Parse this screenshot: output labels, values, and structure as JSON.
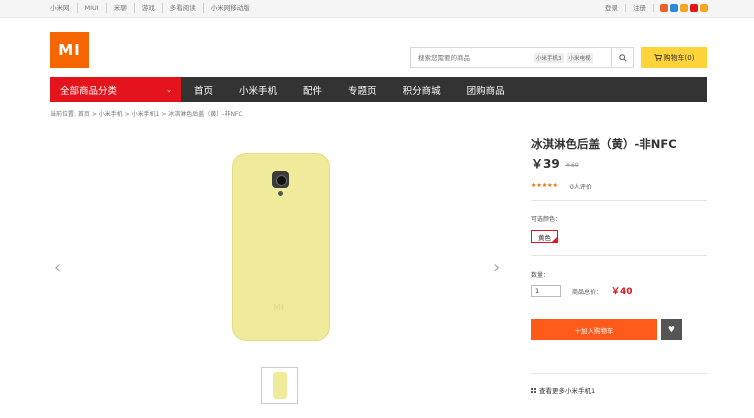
{
  "topbar": {
    "links": [
      "小米网",
      "MIUI",
      "米聊",
      "游戏",
      "多看阅读",
      "小米网移动版"
    ],
    "login": "登录",
    "register": "注册",
    "social_colors": [
      "#e8632c",
      "#2b8bd6",
      "#f5a623",
      "#e4141c",
      "#f5a623"
    ]
  },
  "header": {
    "logo_text": "MI",
    "logo_color": "#f56600",
    "search_placeholder": "搜索您需要的商品",
    "search_tags": [
      "小米手机3",
      "小米电视"
    ],
    "cart_label": "购物车(0)",
    "cart_color": "#ffd43b"
  },
  "nav": {
    "category_label": "全部商品分类",
    "category_color": "#e4141c",
    "items": [
      "首页",
      "小米手机",
      "配件",
      "专题页",
      "积分商城",
      "团购商品"
    ]
  },
  "breadcrumb": "当前位置: 首页 > 小米手机 > 小米手机1 > 冰淇淋色后盖（黄）-非NFC",
  "product": {
    "title": "冰淇淋色后盖（黄）-非NFC",
    "price": "￥39",
    "old_price": "￥69",
    "stars": "★★★★★",
    "rating_value": 5,
    "reviews": "0人评价",
    "color_label": "可选颜色：",
    "color_option": "黄色",
    "qty_label": "数量：",
    "qty_value": "1",
    "total_label": "商品总价：",
    "total_value": "￥40",
    "add_to_cart": "十加入购物车",
    "add_to_cart_color": "#ff5a1a",
    "more_link": "查看更多小米手机1",
    "swatch_color": "#f0eb9a"
  },
  "gallery": {
    "prev_icon": "chevron-left-icon",
    "next_icon": "chevron-right-icon"
  }
}
